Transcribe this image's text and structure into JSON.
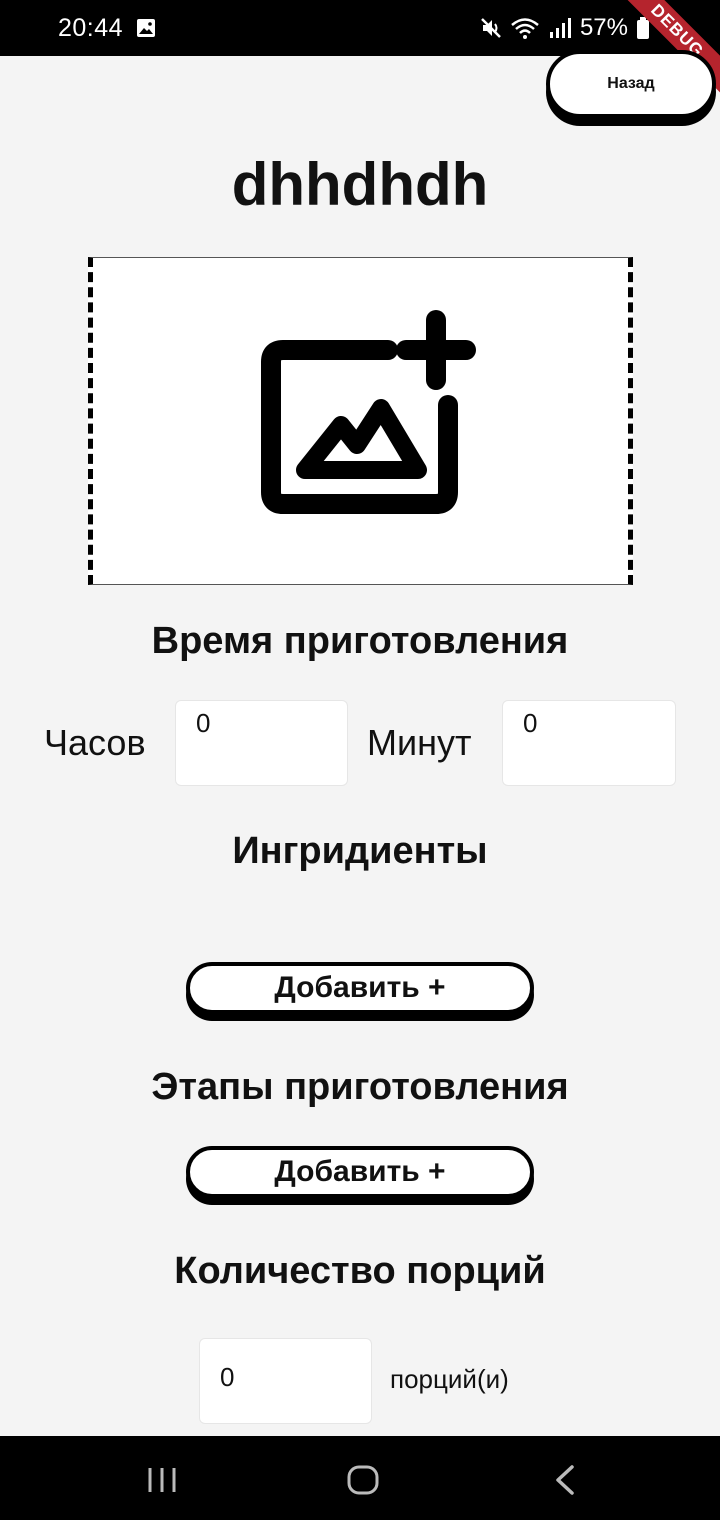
{
  "status_bar": {
    "time": "20:44",
    "battery": "57%"
  },
  "debug_banner": "DEBUG",
  "header": {
    "back_label": "Назад"
  },
  "recipe": {
    "title": "dhhdhdh"
  },
  "image_picker": {
    "icon": "add-photo-icon"
  },
  "cook_time": {
    "title": "Время приготовления",
    "hours_label": "Часов",
    "hours_value": "0",
    "minutes_label": "Минут",
    "minutes_value": "0"
  },
  "ingredients": {
    "title": "Ингридиенты",
    "add_label": "Добавить +"
  },
  "steps": {
    "title": "Этапы приготовления",
    "add_label": "Добавить +"
  },
  "portions": {
    "title": "Количество порций",
    "value": "0",
    "suffix": "порций(и)"
  },
  "nav_bar": {
    "icons": [
      "recent-apps-icon",
      "home-icon",
      "back-icon"
    ]
  }
}
